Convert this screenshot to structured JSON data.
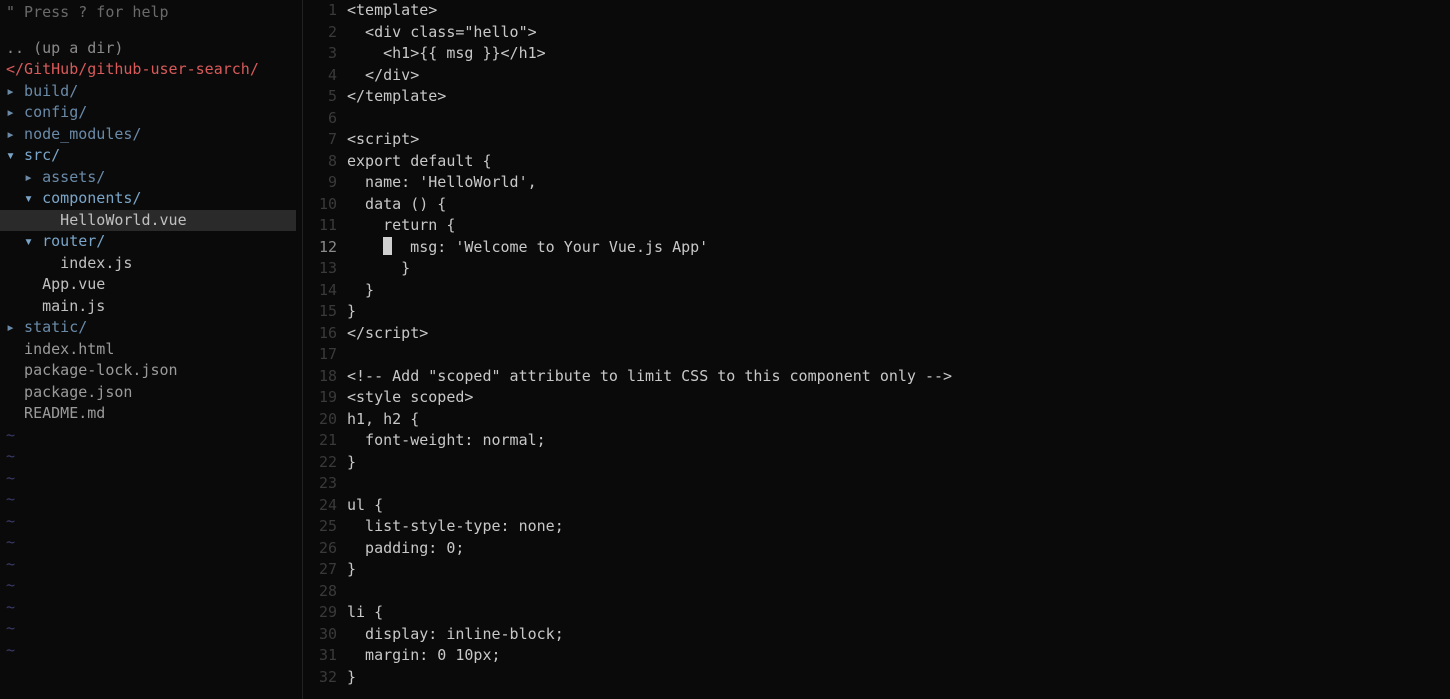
{
  "sidebar": {
    "help": "\" Press ? for help",
    "up_dir": ".. (up a dir)",
    "breadcrumb": "</GitHub/github-user-search/",
    "tree": [
      {
        "indent": 0,
        "arrow": "▸",
        "label": "build/",
        "cls": "folder-closed"
      },
      {
        "indent": 0,
        "arrow": "▸",
        "label": "config/",
        "cls": "folder-closed"
      },
      {
        "indent": 0,
        "arrow": "▸",
        "label": "node_modules/",
        "cls": "folder-closed"
      },
      {
        "indent": 0,
        "arrow": "▾",
        "label": "src/",
        "cls": "folder-open"
      },
      {
        "indent": 1,
        "arrow": "▸",
        "label": "assets/",
        "cls": "folder-closed"
      },
      {
        "indent": 1,
        "arrow": "▾",
        "label": "components/",
        "cls": "folder-open"
      },
      {
        "indent": 2,
        "arrow": " ",
        "label": "HelloWorld.vue",
        "cls": "file",
        "selected": true
      },
      {
        "indent": 1,
        "arrow": "▾",
        "label": "router/",
        "cls": "folder-open"
      },
      {
        "indent": 2,
        "arrow": " ",
        "label": "index.js",
        "cls": "file"
      },
      {
        "indent": 1,
        "arrow": " ",
        "label": "App.vue",
        "cls": "file"
      },
      {
        "indent": 1,
        "arrow": " ",
        "label": "main.js",
        "cls": "file"
      },
      {
        "indent": 0,
        "arrow": "▸",
        "label": "static/",
        "cls": "folder-closed"
      },
      {
        "indent": 0,
        "arrow": " ",
        "label": "index.html",
        "cls": "file-dim"
      },
      {
        "indent": 0,
        "arrow": " ",
        "label": "package-lock.json",
        "cls": "file-dim"
      },
      {
        "indent": 0,
        "arrow": " ",
        "label": "package.json",
        "cls": "file-dim"
      },
      {
        "indent": 0,
        "arrow": " ",
        "label": "README.md",
        "cls": "file-dim"
      }
    ],
    "tilde": "~"
  },
  "editor": {
    "current_line": 12,
    "lines": [
      {
        "n": 1,
        "t": "<template>"
      },
      {
        "n": 2,
        "t": "  <div class=\"hello\">"
      },
      {
        "n": 3,
        "t": "    <h1>{{ msg }}</h1>"
      },
      {
        "n": 4,
        "t": "  </div>"
      },
      {
        "n": 5,
        "t": "</template>"
      },
      {
        "n": 6,
        "t": ""
      },
      {
        "n": 7,
        "t": "<script>"
      },
      {
        "n": 8,
        "t": "export default {"
      },
      {
        "n": 9,
        "t": "  name: 'HelloWorld',"
      },
      {
        "n": 10,
        "t": "  data () {"
      },
      {
        "n": 11,
        "t": "    return {"
      },
      {
        "n": 12,
        "t": "      msg: 'Welcome to Your Vue.js App'",
        "cursor_at": 4
      },
      {
        "n": 13,
        "t": "      }"
      },
      {
        "n": 14,
        "t": "  }"
      },
      {
        "n": 15,
        "t": "}"
      },
      {
        "n": 16,
        "t": "</script>"
      },
      {
        "n": 17,
        "t": ""
      },
      {
        "n": 18,
        "t": "<!-- Add \"scoped\" attribute to limit CSS to this component only -->"
      },
      {
        "n": 19,
        "t": "<style scoped>"
      },
      {
        "n": 20,
        "t": "h1, h2 {"
      },
      {
        "n": 21,
        "t": "  font-weight: normal;"
      },
      {
        "n": 22,
        "t": "}"
      },
      {
        "n": 23,
        "t": ""
      },
      {
        "n": 24,
        "t": "ul {"
      },
      {
        "n": 25,
        "t": "  list-style-type: none;"
      },
      {
        "n": 26,
        "t": "  padding: 0;"
      },
      {
        "n": 27,
        "t": "}"
      },
      {
        "n": 28,
        "t": ""
      },
      {
        "n": 29,
        "t": "li {"
      },
      {
        "n": 30,
        "t": "  display: inline-block;"
      },
      {
        "n": 31,
        "t": "  margin: 0 10px;"
      },
      {
        "n": 32,
        "t": "}"
      }
    ]
  }
}
